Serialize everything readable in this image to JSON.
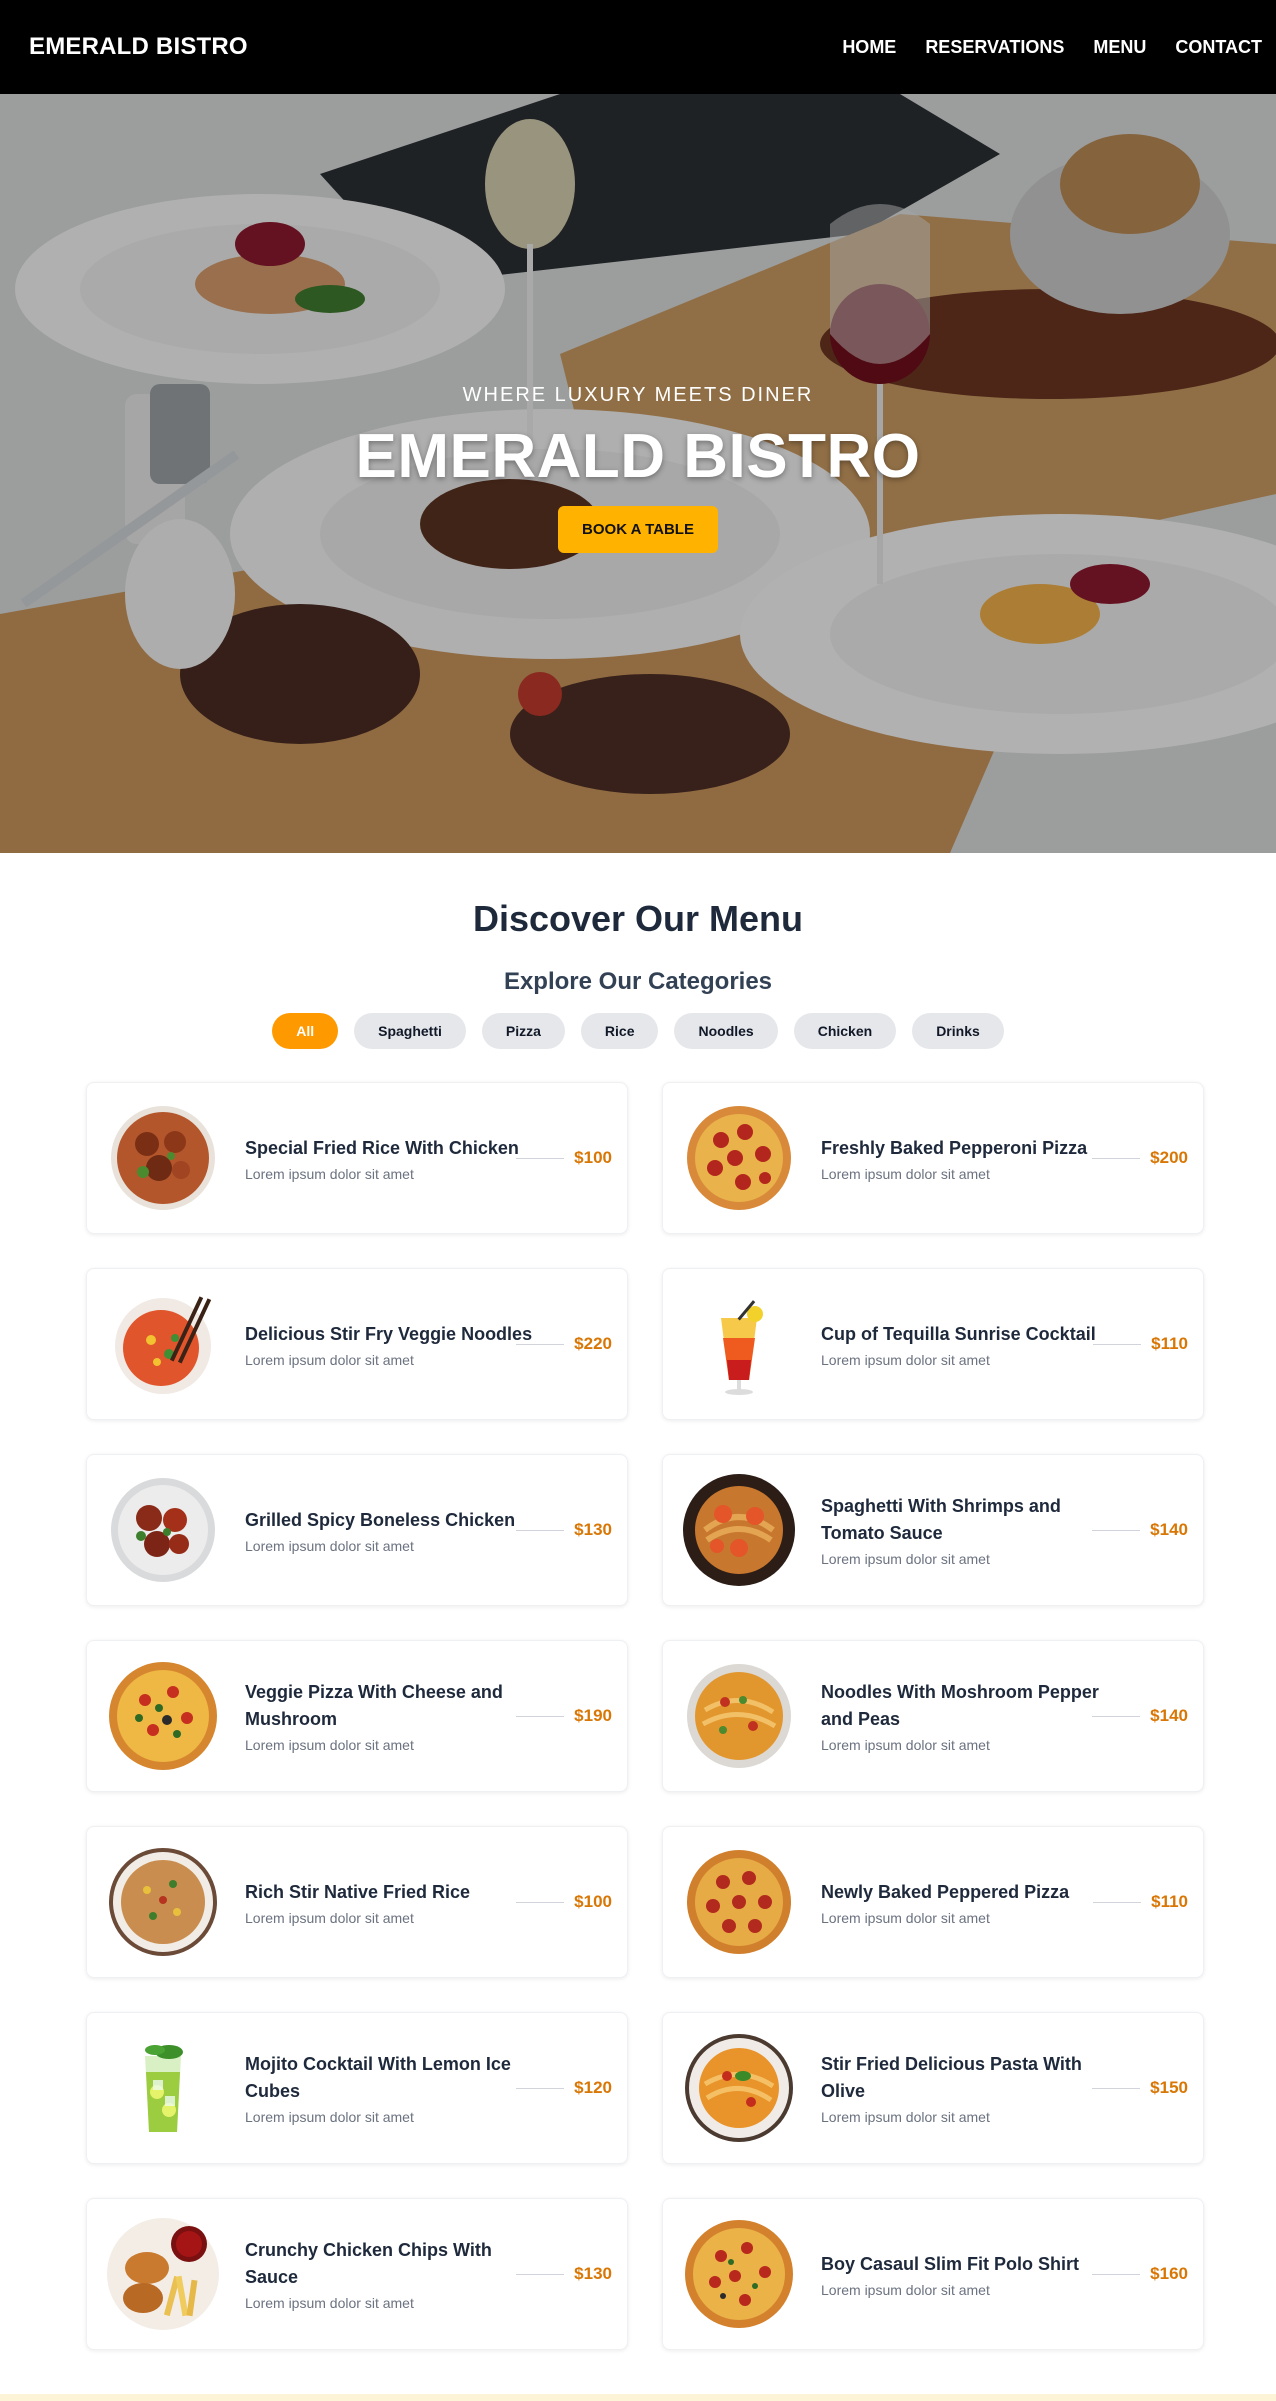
{
  "nav": {
    "brand": "EMERALD BISTRO",
    "links": [
      "HOME",
      "RESERVATIONS",
      "MENU",
      "CONTACT"
    ]
  },
  "hero": {
    "tagline": "WHERE LUXURY MEETS DINER",
    "title": "EMERALD BISTRO",
    "cta": "BOOK A TABLE"
  },
  "menu": {
    "title": "Discover Our Menu",
    "subtitle": "Explore Our Categories",
    "categories": [
      "All",
      "Spaghetti",
      "Pizza",
      "Rice",
      "Noodles",
      "Chicken",
      "Drinks"
    ],
    "active_category": "All",
    "items": [
      {
        "name": "Special Fried Rice With Chicken",
        "desc": "Lorem ipsum dolor sit amet",
        "price": "$100",
        "icon": "fried-rice-chicken-icon"
      },
      {
        "name": "Freshly Baked Pepperoni Pizza",
        "desc": "Lorem ipsum dolor sit amet",
        "price": "$200",
        "icon": "pepperoni-pizza-icon"
      },
      {
        "name": "Delicious Stir Fry Veggie Noodles",
        "desc": "Lorem ipsum dolor sit amet",
        "price": "$220",
        "icon": "veggie-noodles-icon"
      },
      {
        "name": "Cup of Tequilla Sunrise Cocktail",
        "desc": "Lorem ipsum dolor sit amet",
        "price": "$110",
        "icon": "tequila-sunrise-icon"
      },
      {
        "name": "Grilled Spicy Boneless Chicken",
        "desc": "Lorem ipsum dolor sit amet",
        "price": "$130",
        "icon": "grilled-chicken-icon"
      },
      {
        "name": "Spaghetti With Shrimps and Tomato Sauce",
        "desc": "Lorem ipsum dolor sit amet",
        "price": "$140",
        "icon": "shrimp-spaghetti-icon"
      },
      {
        "name": "Veggie Pizza With Cheese and Mushroom",
        "desc": "Lorem ipsum dolor sit amet",
        "price": "$190",
        "icon": "veggie-pizza-icon"
      },
      {
        "name": "Noodles With Moshroom Pepper and Peas",
        "desc": "Lorem ipsum dolor sit amet",
        "price": "$140",
        "icon": "mushroom-noodles-icon"
      },
      {
        "name": "Rich Stir Native Fried Rice",
        "desc": "Lorem ipsum dolor sit amet",
        "price": "$100",
        "icon": "native-fried-rice-icon"
      },
      {
        "name": "Newly Baked Peppered Pizza",
        "desc": "Lorem ipsum dolor sit amet",
        "price": "$110",
        "icon": "peppered-pizza-icon"
      },
      {
        "name": "Mojito Cocktail With Lemon Ice Cubes",
        "desc": "Lorem ipsum dolor sit amet",
        "price": "$120",
        "icon": "mojito-icon"
      },
      {
        "name": "Stir Fried Delicious Pasta With Olive",
        "desc": "Lorem ipsum dolor sit amet",
        "price": "$150",
        "icon": "olive-pasta-icon"
      },
      {
        "name": "Crunchy Chicken Chips With Sauce",
        "desc": "Lorem ipsum dolor sit amet",
        "price": "$130",
        "icon": "chicken-chips-icon"
      },
      {
        "name": "Boy Casaul Slim Fit Polo Shirt",
        "desc": "Lorem ipsum dolor sit amet",
        "price": "$160",
        "icon": "pizza-icon"
      }
    ]
  },
  "colors": {
    "accent": "#ff9900",
    "cta": "#ffb300",
    "price": "#d97706",
    "nav_bg": "#000000"
  }
}
